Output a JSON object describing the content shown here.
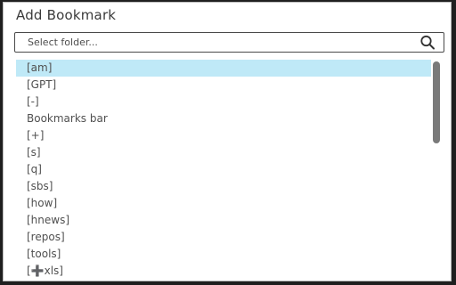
{
  "dialog": {
    "title": "Add Bookmark"
  },
  "search": {
    "placeholder": "Select folder..."
  },
  "folders": {
    "items": [
      {
        "label": "[am]",
        "selected": true
      },
      {
        "label": "[GPT]"
      },
      {
        "label": "[-]"
      },
      {
        "label": "Bookmarks bar"
      },
      {
        "label": "[+]"
      },
      {
        "label": "[s]"
      },
      {
        "label": "[q]"
      },
      {
        "label": "[sbs]"
      },
      {
        "label": "[how]"
      },
      {
        "label": "[hnews]"
      },
      {
        "label": "[repos]"
      },
      {
        "label": "[tools]"
      },
      {
        "label": "[➕xls]"
      }
    ]
  },
  "colors": {
    "selected_background": "#bfe9f7",
    "text": "#505050"
  },
  "icons": {
    "search": "search-icon"
  }
}
